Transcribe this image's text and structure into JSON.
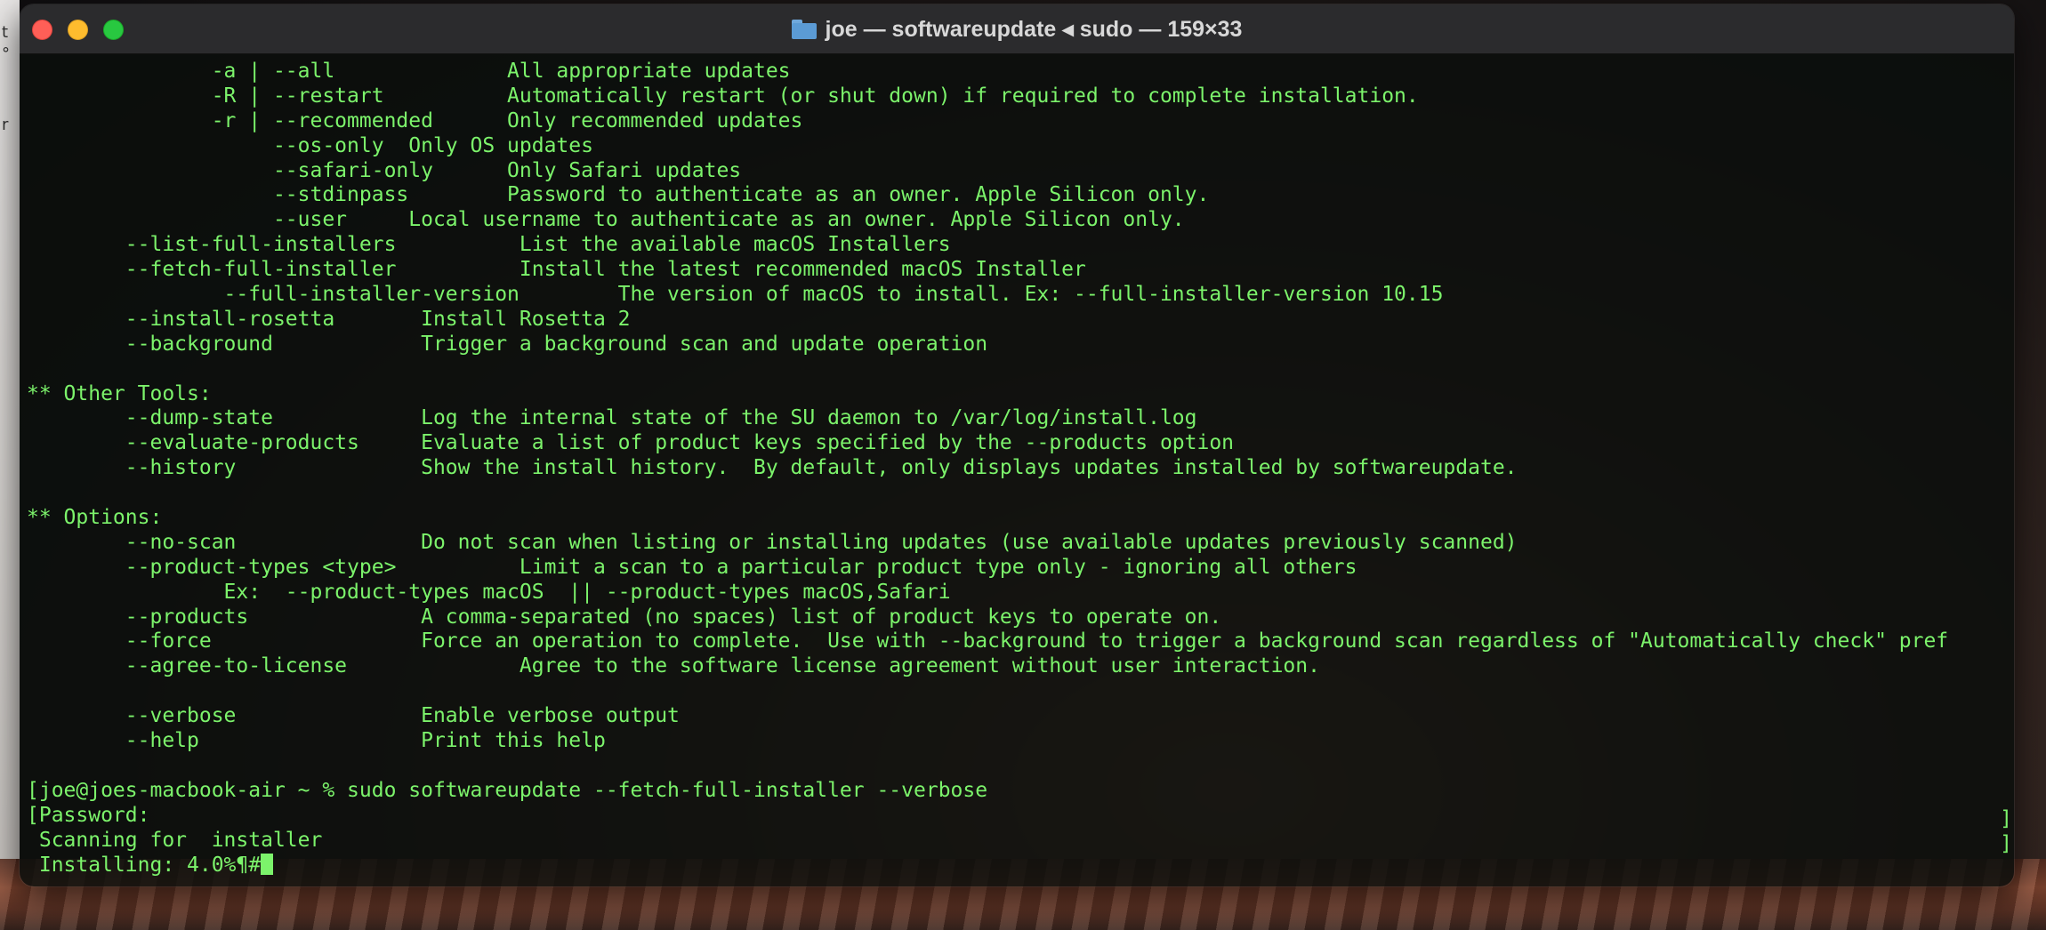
{
  "window": {
    "title": "joe — softwareupdate ◂ sudo — 159×33"
  },
  "desktop_left_glyphs": [
    "t",
    "°",
    "r"
  ],
  "terminal": {
    "lines": [
      "               -a | --all              All appropriate updates",
      "               -R | --restart          Automatically restart (or shut down) if required to complete installation.",
      "               -r | --recommended      Only recommended updates",
      "                    --os-only  Only OS updates",
      "                    --safari-only      Only Safari updates",
      "                    --stdinpass        Password to authenticate as an owner. Apple Silicon only.",
      "                    --user     Local username to authenticate as an owner. Apple Silicon only.",
      "        --list-full-installers          List the available macOS Installers",
      "        --fetch-full-installer          Install the latest recommended macOS Installer",
      "                --full-installer-version        The version of macOS to install. Ex: --full-installer-version 10.15",
      "        --install-rosetta       Install Rosetta 2",
      "        --background            Trigger a background scan and update operation",
      "",
      "** Other Tools:",
      "        --dump-state            Log the internal state of the SU daemon to /var/log/install.log",
      "        --evaluate-products     Evaluate a list of product keys specified by the --products option",
      "        --history               Show the install history.  By default, only displays updates installed by softwareupdate.",
      "",
      "** Options:",
      "        --no-scan               Do not scan when listing or installing updates (use available updates previously scanned)",
      "        --product-types <type>          Limit a scan to a particular product type only - ignoring all others",
      "                Ex:  --product-types macOS  || --product-types macOS,Safari",
      "        --products              A comma-separated (no spaces) list of product keys to operate on.",
      "        --force                 Force an operation to complete.  Use with --background to trigger a background scan regardless of \"Automatically check\" pref",
      "        --agree-to-license              Agree to the software license agreement without user interaction.",
      "",
      "        --verbose               Enable verbose output",
      "        --help                  Print this help",
      "",
      "[joe@joes-macbook-air ~ % sudo softwareupdate --fetch-full-installer --verbose",
      "[Password:",
      " Scanning for  installer",
      " Installing: 4.0%¶#"
    ],
    "right_brackets": [
      "]",
      "]"
    ],
    "colors": {
      "text": "#7cf36b",
      "background": "#0a0e0c"
    }
  }
}
